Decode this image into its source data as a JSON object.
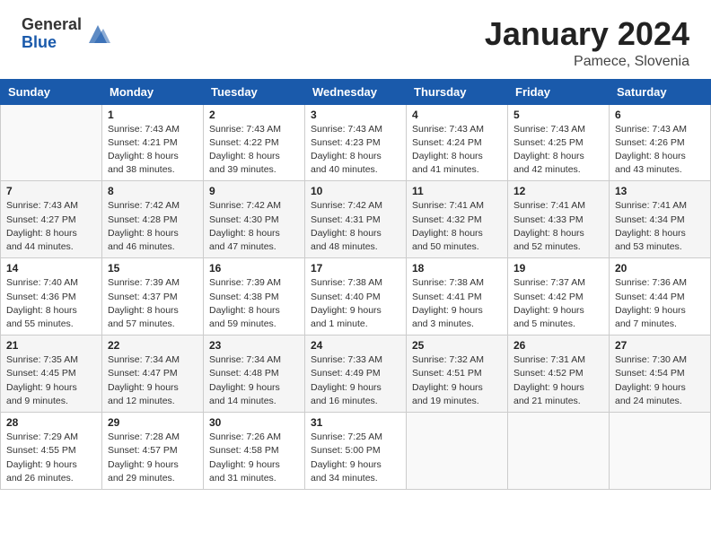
{
  "header": {
    "logo_general": "General",
    "logo_blue": "Blue",
    "month_title": "January 2024",
    "subtitle": "Pamece, Slovenia"
  },
  "days_of_week": [
    "Sunday",
    "Monday",
    "Tuesday",
    "Wednesday",
    "Thursday",
    "Friday",
    "Saturday"
  ],
  "weeks": [
    [
      {
        "day": "",
        "info": ""
      },
      {
        "day": "1",
        "info": "Sunrise: 7:43 AM\nSunset: 4:21 PM\nDaylight: 8 hours\nand 38 minutes."
      },
      {
        "day": "2",
        "info": "Sunrise: 7:43 AM\nSunset: 4:22 PM\nDaylight: 8 hours\nand 39 minutes."
      },
      {
        "day": "3",
        "info": "Sunrise: 7:43 AM\nSunset: 4:23 PM\nDaylight: 8 hours\nand 40 minutes."
      },
      {
        "day": "4",
        "info": "Sunrise: 7:43 AM\nSunset: 4:24 PM\nDaylight: 8 hours\nand 41 minutes."
      },
      {
        "day": "5",
        "info": "Sunrise: 7:43 AM\nSunset: 4:25 PM\nDaylight: 8 hours\nand 42 minutes."
      },
      {
        "day": "6",
        "info": "Sunrise: 7:43 AM\nSunset: 4:26 PM\nDaylight: 8 hours\nand 43 minutes."
      }
    ],
    [
      {
        "day": "7",
        "info": "Sunrise: 7:43 AM\nSunset: 4:27 PM\nDaylight: 8 hours\nand 44 minutes."
      },
      {
        "day": "8",
        "info": "Sunrise: 7:42 AM\nSunset: 4:28 PM\nDaylight: 8 hours\nand 46 minutes."
      },
      {
        "day": "9",
        "info": "Sunrise: 7:42 AM\nSunset: 4:30 PM\nDaylight: 8 hours\nand 47 minutes."
      },
      {
        "day": "10",
        "info": "Sunrise: 7:42 AM\nSunset: 4:31 PM\nDaylight: 8 hours\nand 48 minutes."
      },
      {
        "day": "11",
        "info": "Sunrise: 7:41 AM\nSunset: 4:32 PM\nDaylight: 8 hours\nand 50 minutes."
      },
      {
        "day": "12",
        "info": "Sunrise: 7:41 AM\nSunset: 4:33 PM\nDaylight: 8 hours\nand 52 minutes."
      },
      {
        "day": "13",
        "info": "Sunrise: 7:41 AM\nSunset: 4:34 PM\nDaylight: 8 hours\nand 53 minutes."
      }
    ],
    [
      {
        "day": "14",
        "info": "Sunrise: 7:40 AM\nSunset: 4:36 PM\nDaylight: 8 hours\nand 55 minutes."
      },
      {
        "day": "15",
        "info": "Sunrise: 7:39 AM\nSunset: 4:37 PM\nDaylight: 8 hours\nand 57 minutes."
      },
      {
        "day": "16",
        "info": "Sunrise: 7:39 AM\nSunset: 4:38 PM\nDaylight: 8 hours\nand 59 minutes."
      },
      {
        "day": "17",
        "info": "Sunrise: 7:38 AM\nSunset: 4:40 PM\nDaylight: 9 hours\nand 1 minute."
      },
      {
        "day": "18",
        "info": "Sunrise: 7:38 AM\nSunset: 4:41 PM\nDaylight: 9 hours\nand 3 minutes."
      },
      {
        "day": "19",
        "info": "Sunrise: 7:37 AM\nSunset: 4:42 PM\nDaylight: 9 hours\nand 5 minutes."
      },
      {
        "day": "20",
        "info": "Sunrise: 7:36 AM\nSunset: 4:44 PM\nDaylight: 9 hours\nand 7 minutes."
      }
    ],
    [
      {
        "day": "21",
        "info": "Sunrise: 7:35 AM\nSunset: 4:45 PM\nDaylight: 9 hours\nand 9 minutes."
      },
      {
        "day": "22",
        "info": "Sunrise: 7:34 AM\nSunset: 4:47 PM\nDaylight: 9 hours\nand 12 minutes."
      },
      {
        "day": "23",
        "info": "Sunrise: 7:34 AM\nSunset: 4:48 PM\nDaylight: 9 hours\nand 14 minutes."
      },
      {
        "day": "24",
        "info": "Sunrise: 7:33 AM\nSunset: 4:49 PM\nDaylight: 9 hours\nand 16 minutes."
      },
      {
        "day": "25",
        "info": "Sunrise: 7:32 AM\nSunset: 4:51 PM\nDaylight: 9 hours\nand 19 minutes."
      },
      {
        "day": "26",
        "info": "Sunrise: 7:31 AM\nSunset: 4:52 PM\nDaylight: 9 hours\nand 21 minutes."
      },
      {
        "day": "27",
        "info": "Sunrise: 7:30 AM\nSunset: 4:54 PM\nDaylight: 9 hours\nand 24 minutes."
      }
    ],
    [
      {
        "day": "28",
        "info": "Sunrise: 7:29 AM\nSunset: 4:55 PM\nDaylight: 9 hours\nand 26 minutes."
      },
      {
        "day": "29",
        "info": "Sunrise: 7:28 AM\nSunset: 4:57 PM\nDaylight: 9 hours\nand 29 minutes."
      },
      {
        "day": "30",
        "info": "Sunrise: 7:26 AM\nSunset: 4:58 PM\nDaylight: 9 hours\nand 31 minutes."
      },
      {
        "day": "31",
        "info": "Sunrise: 7:25 AM\nSunset: 5:00 PM\nDaylight: 9 hours\nand 34 minutes."
      },
      {
        "day": "",
        "info": ""
      },
      {
        "day": "",
        "info": ""
      },
      {
        "day": "",
        "info": ""
      }
    ]
  ]
}
